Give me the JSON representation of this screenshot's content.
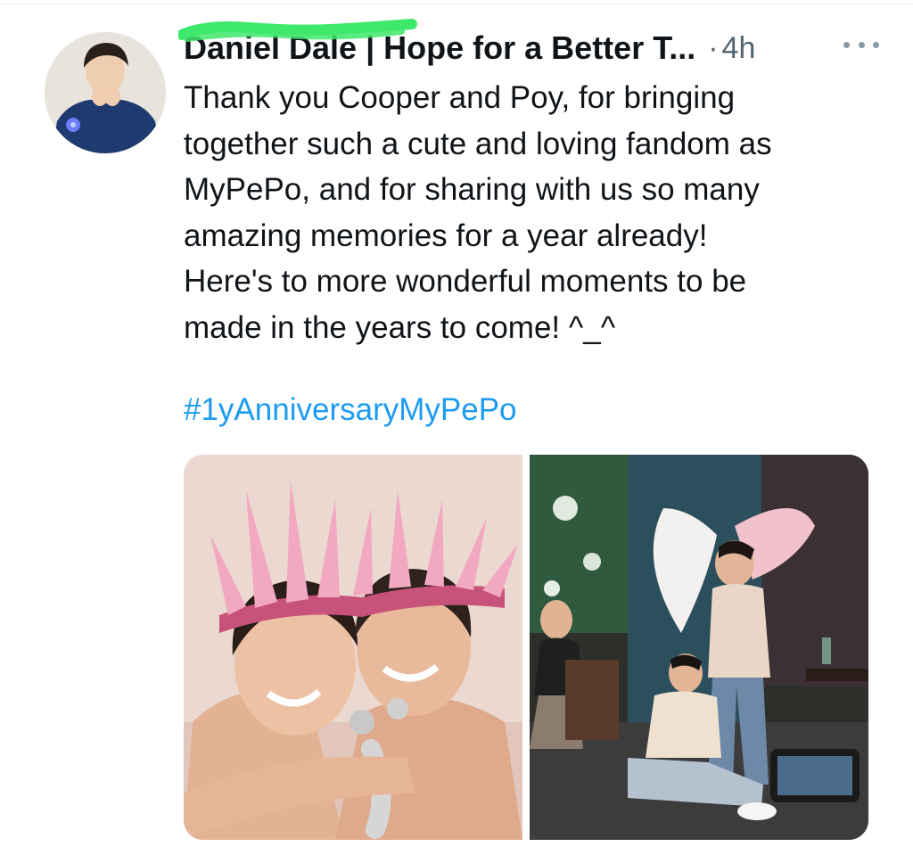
{
  "tweet": {
    "author_name": "Daniel Dale | Hope for a Better T...",
    "separator": "·",
    "timestamp": "4h",
    "more_icon": "more-horizontal-icon",
    "text_lines": [
      "Thank you Cooper and Poy, for bringing",
      "together such a cute and loving fandom as",
      "MyPePo, and for sharing with us so many",
      "amazing memories for a year already!",
      "Here's to more wonderful moments to be",
      "made in the years to come! ^_^"
    ],
    "hashtag": "#1yAnniversaryMyPePo",
    "colors": {
      "hashtag": "#1d9bf0",
      "secondary_text": "#536471",
      "redaction_marker": "#3ee86b"
    },
    "media": [
      {
        "name": "photo-couple-feather-crowns"
      },
      {
        "name": "photo-behind-the-scenes-angel-wings"
      }
    ]
  }
}
